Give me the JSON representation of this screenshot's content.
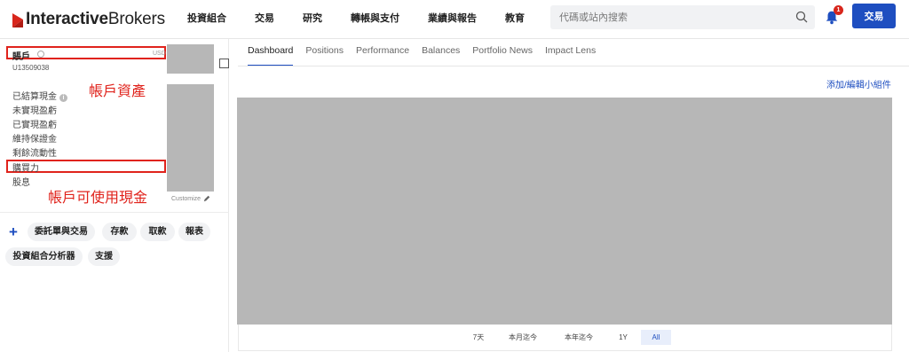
{
  "brand": {
    "name_bold": "Interactive",
    "name_rest": "Brokers"
  },
  "nav": [
    "投資組合",
    "交易",
    "研究",
    "轉帳與支付",
    "業績與報告",
    "教育"
  ],
  "search": {
    "placeholder": "代碼或站內搜索"
  },
  "notifications": {
    "count": "1"
  },
  "trade_button": "交易",
  "account": {
    "title": "賬戶",
    "currency": "USD",
    "id": "U13509038",
    "customize": "Customize"
  },
  "metrics": [
    "已結算現金",
    "未實現盈虧",
    "已實現盈虧",
    "維持保證金",
    "剩餘流動性",
    "購買力",
    "股息"
  ],
  "annotations": {
    "account_assets": "帳戶資產",
    "available_cash": "帳戶可使用現金"
  },
  "actions": [
    "委託單與交易",
    "存款",
    "取款",
    "報表",
    "投資組合分析器",
    "支援"
  ],
  "tabs": [
    "Dashboard",
    "Positions",
    "Performance",
    "Balances",
    "Portfolio News",
    "Impact Lens"
  ],
  "add_widget": "添加/編輯小組件",
  "ranges": [
    "7天",
    "本月迄今",
    "本年迄今",
    "1Y",
    "All"
  ],
  "colors": {
    "accent": "#1e4ec0",
    "annotation": "#e0231c",
    "placeholder_gray": "#b7b7b7"
  }
}
